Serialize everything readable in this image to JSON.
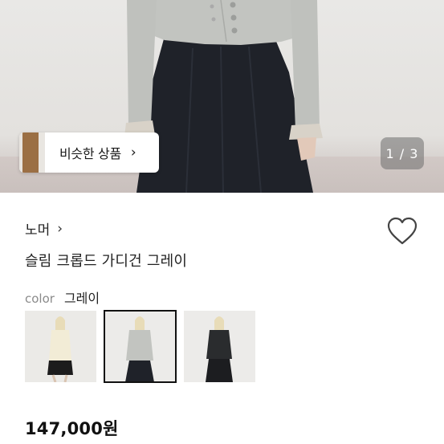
{
  "hero": {
    "similar_label": "비슷한 상품",
    "similar_arrow": "›",
    "page_counter": "1 / 3"
  },
  "product": {
    "brand": "노머",
    "brand_arrow": "›",
    "title": "슬림 크롭드 가디건 그레이",
    "color_key": "color",
    "color_value": "그레이",
    "price": "147,000원",
    "swatches": [
      {
        "name": "ivory"
      },
      {
        "name": "gray",
        "selected": true
      },
      {
        "name": "charcoal"
      }
    ]
  },
  "colors": {
    "cardigan_gray": "#c2c4c0",
    "skirt_black": "#1f2229",
    "heart_stroke": "#444444"
  },
  "icons": {
    "heart": "heart-outline-icon",
    "chevron": "chevron-right-icon"
  }
}
